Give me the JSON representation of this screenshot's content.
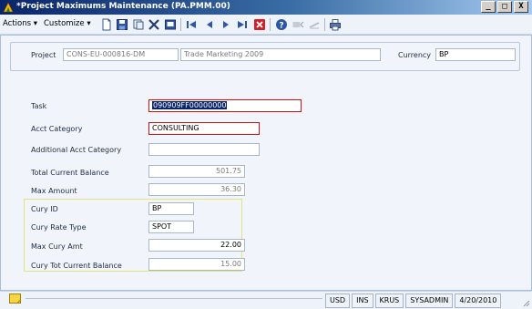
{
  "window": {
    "title": "*Project Maximums Maintenance (PA.PMM.00)",
    "controls": [
      "_",
      "□",
      "X"
    ]
  },
  "toolbar": {
    "actions_label": "Actions",
    "customize_label": "Customize",
    "icons": [
      "new-icon",
      "save-icon",
      "copy-icon",
      "delete-icon",
      "finder-icon",
      "first-record-icon",
      "previous-record-icon",
      "next-record-icon",
      "last-record-icon",
      "cancel-icon",
      "help-icon",
      "note-icon",
      "attachment-icon",
      "print-icon"
    ]
  },
  "header": {
    "project_label": "Project",
    "project_id": "CONS-EU-000816-DM",
    "project_desc": "Trade Marketing 2009",
    "currency_label": "Currency",
    "currency_value": "BP"
  },
  "form": {
    "task_label": "Task",
    "task_value": "090909FF00000000",
    "acct_category_label": "Acct Category",
    "acct_category_value": "CONSULTING",
    "additional_acct_category_label": "Additional Acct Category",
    "additional_acct_category_value": "",
    "total_current_balance_label": "Total Current Balance",
    "total_current_balance_value": "501.75",
    "max_amount_label": "Max Amount",
    "max_amount_value": "36.30",
    "cury_id_label": "Cury ID",
    "cury_id_value": "BP",
    "cury_rate_type_label": "Cury Rate Type",
    "cury_rate_type_value": "SPOT",
    "max_cury_amt_label": "Max Cury Amt",
    "max_cury_amt_value": "22.00",
    "cury_tot_current_balance_label": "Cury Tot Current Balance",
    "cury_tot_current_balance_value": "15.00"
  },
  "status": {
    "currency": "USD",
    "ins": "INS",
    "user_short": "KRUS",
    "user": "SYSADMIN",
    "date": "4/20/2010"
  },
  "colors": {
    "title_gradient_start": "#0a246a",
    "title_gradient_end": "#a6caf0",
    "required_border": "#cc1111",
    "group_border": "#e3e37a",
    "selection": "#0a246a"
  }
}
